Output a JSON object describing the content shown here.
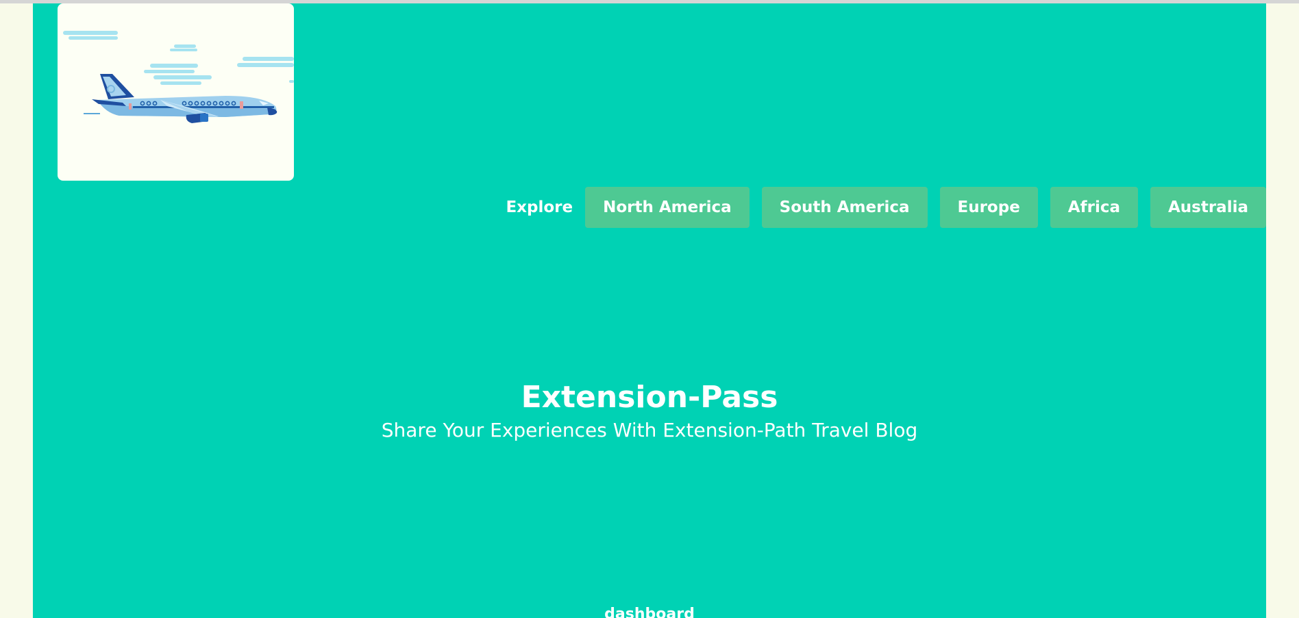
{
  "logo": {
    "icon": "airplane-icon"
  },
  "nav": {
    "label": "Explore",
    "items": [
      {
        "label": "North America"
      },
      {
        "label": "South America"
      },
      {
        "label": "Europe"
      },
      {
        "label": "Africa"
      },
      {
        "label": "Australia"
      }
    ]
  },
  "hero": {
    "title": "Extension-Pass",
    "subtitle": "Share Your Experiences With Extension-Path Travel Blog"
  },
  "footer": {
    "link": "dashboard"
  },
  "colors": {
    "page_background": "#f8fae9",
    "panel_background": "#00d2b4",
    "button_background": "#4ec993",
    "text": "#ffffff"
  }
}
